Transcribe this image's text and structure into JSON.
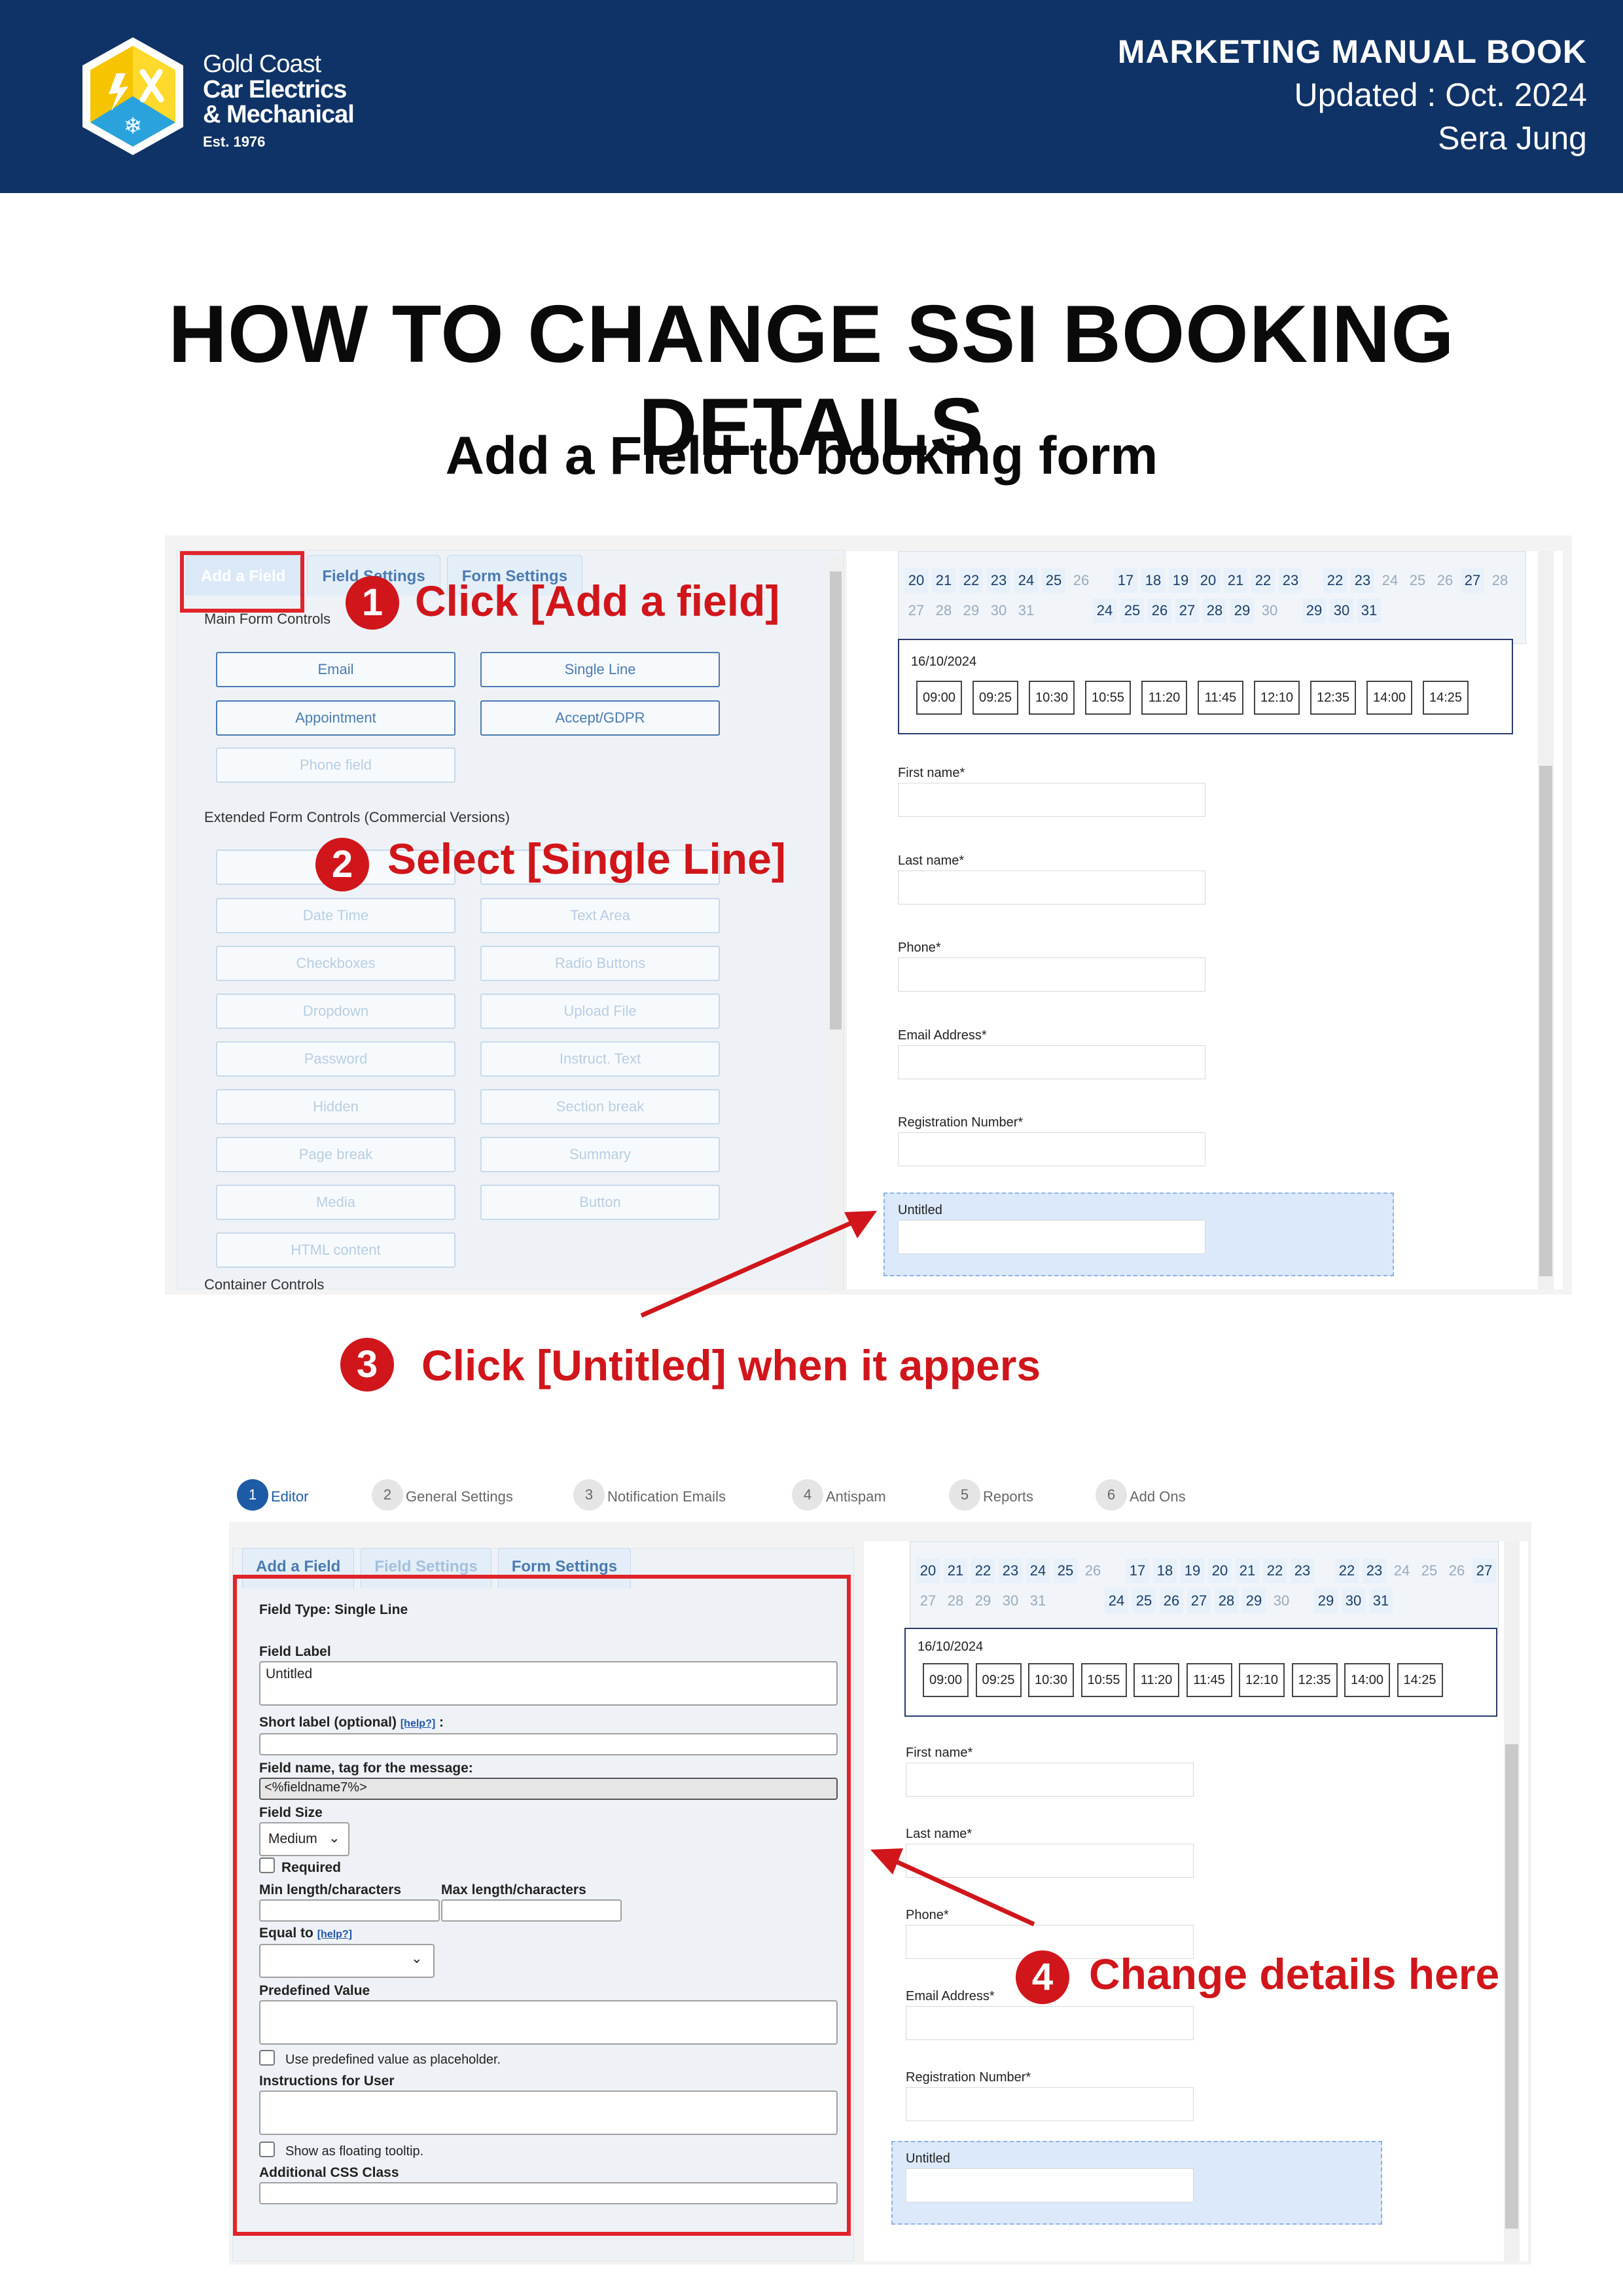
{
  "header": {
    "logo_line1": "Gold Coast",
    "logo_line2": "Car Electrics",
    "logo_line3": "& Mechanical",
    "logo_est": "Est. 1976",
    "manual_title": "MARKETING MANUAL BOOK",
    "updated": "Updated : Oct. 2024",
    "author": "Sera Jung"
  },
  "title": "HOW TO CHANGE SSI BOOKING DETAILS",
  "subtitle": "Add a Field to booking form",
  "callouts": [
    {
      "num": "1",
      "text": "Click [Add a field]"
    },
    {
      "num": "2",
      "text": "Select [Single Line]"
    },
    {
      "num": "3",
      "text": "Click [Untitled] when it appers"
    },
    {
      "num": "4",
      "text": "Change details here"
    }
  ],
  "builder": {
    "tabs": [
      "Add a Field",
      "Field Settings",
      "Form Settings"
    ],
    "main_controls_label": "Main Form Controls",
    "main_controls": [
      "Email",
      "Single Line",
      "Appointment",
      "Accept/GDPR",
      "Phone field"
    ],
    "extended_label": "Extended Form Controls (Commercial Versions)",
    "extended_controls": [
      "Date Time",
      "Text Area",
      "Checkboxes",
      "Radio Buttons",
      "Dropdown",
      "Upload File",
      "Password",
      "Instruct. Text",
      "Hidden",
      "Section break",
      "Page break",
      "Summary",
      "Media",
      "Button",
      "HTML content"
    ],
    "container_label": "Container Controls"
  },
  "calendar": {
    "row1": [
      "20",
      "21",
      "22",
      "23",
      "24",
      "25",
      "26",
      "",
      "17",
      "18",
      "19",
      "20",
      "21",
      "22",
      "23",
      "",
      "22",
      "23",
      "24",
      "25",
      "26",
      "27",
      "28"
    ],
    "row2": [
      "27",
      "28",
      "29",
      "30",
      "31",
      "",
      "",
      "",
      "24",
      "25",
      "26",
      "27",
      "28",
      "29",
      "30",
      "",
      "29",
      "30",
      "31",
      "",
      "",
      "",
      ""
    ],
    "date": "16/10/2024",
    "slots": [
      "09:00",
      "09:25",
      "10:30",
      "10:55",
      "11:20",
      "11:45",
      "12:10",
      "12:35",
      "14:00",
      "14:25"
    ]
  },
  "form_fields": [
    "First name*",
    "Last name*",
    "Phone*",
    "Email Address*",
    "Registration Number*",
    "Untitled"
  ],
  "wizard_steps": [
    {
      "num": "1",
      "label": "Editor"
    },
    {
      "num": "2",
      "label": "General Settings"
    },
    {
      "num": "3",
      "label": "Notification Emails"
    },
    {
      "num": "4",
      "label": "Antispam"
    },
    {
      "num": "5",
      "label": "Reports"
    },
    {
      "num": "6",
      "label": "Add Ons"
    }
  ],
  "editor": {
    "field_type": "Field Type: Single Line",
    "field_label": "Field Label",
    "field_label_value": "Untitled",
    "short_label": "Short label (optional)",
    "help": "[help?]",
    "short_label_colon": ":",
    "field_name": "Field name, tag for the message:",
    "field_name_value": "<%fieldname7%>",
    "field_size": "Field Size",
    "field_size_value": "Medium",
    "required": "Required",
    "min_length": "Min length/characters",
    "max_length": "Max length/characters",
    "equal_to": "Equal to",
    "predefined": "Predefined Value",
    "use_predefined": "Use predefined value as placeholder.",
    "instructions": "Instructions for User",
    "show_tooltip": "Show as floating tooltip.",
    "css_class": "Additional CSS Class"
  },
  "colors": {
    "header_bg": "#0f3366",
    "accent_red": "#d0161b",
    "link_blue": "#4a7bb2"
  }
}
